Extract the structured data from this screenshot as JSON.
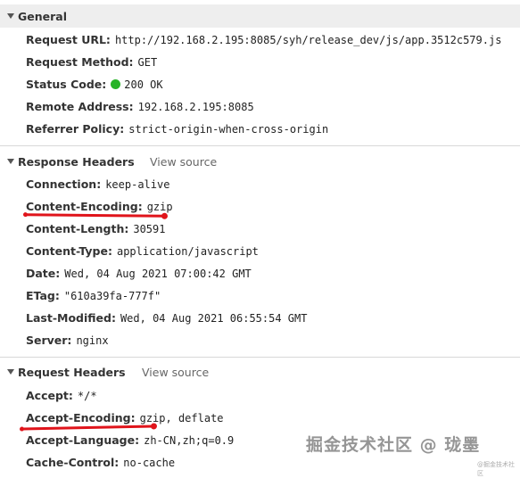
{
  "general": {
    "title": "General",
    "rows": [
      {
        "key": "Request URL:",
        "value": "http://192.168.2.195:8085/syh/release_dev/js/app.3512c579.js"
      },
      {
        "key": "Request Method:",
        "value": "GET"
      },
      {
        "key": "Status Code:",
        "value": "200 OK"
      },
      {
        "key": "Remote Address:",
        "value": "192.168.2.195:8085"
      },
      {
        "key": "Referrer Policy:",
        "value": "strict-origin-when-cross-origin"
      }
    ]
  },
  "response_headers": {
    "title": "Response Headers",
    "view_source": "View source",
    "rows": [
      {
        "key": "Connection:",
        "value": "keep-alive"
      },
      {
        "key": "Content-Encoding:",
        "value": "gzip"
      },
      {
        "key": "Content-Length:",
        "value": "30591"
      },
      {
        "key": "Content-Type:",
        "value": "application/javascript"
      },
      {
        "key": "Date:",
        "value": "Wed, 04 Aug 2021 07:00:42 GMT"
      },
      {
        "key": "ETag:",
        "value": "\"610a39fa-777f\""
      },
      {
        "key": "Last-Modified:",
        "value": "Wed, 04 Aug 2021 06:55:54 GMT"
      },
      {
        "key": "Server:",
        "value": "nginx"
      }
    ]
  },
  "request_headers": {
    "title": "Request Headers",
    "view_source": "View source",
    "rows": [
      {
        "key": "Accept:",
        "value": "*/*"
      },
      {
        "key": "Accept-Encoding:",
        "value": "gzip, deflate"
      },
      {
        "key": "Accept-Language:",
        "value": "zh-CN,zh;q=0.9"
      },
      {
        "key": "Cache-Control:",
        "value": "no-cache"
      }
    ]
  },
  "watermark": {
    "text": "掘金技术社区 @ 珑墨",
    "sub": "@掘金技术社区"
  },
  "colors": {
    "status_ok": "#27b327",
    "annotation": "#e0141b",
    "header_bg": "#eeeeee"
  }
}
